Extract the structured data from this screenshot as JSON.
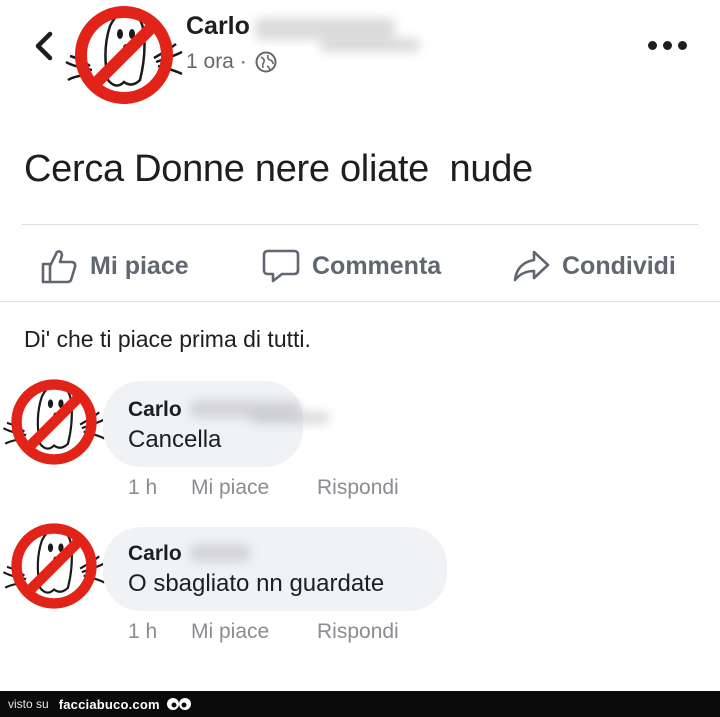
{
  "header": {
    "author_name": "Carlo",
    "timestamp": "1 ora ·",
    "icons": {
      "back": "chevron-left-icon",
      "privacy": "globe-icon",
      "more": "more-dots-icon"
    }
  },
  "post": {
    "text": "Cerca Donne nere oliate  nude"
  },
  "actions": {
    "like": {
      "label": "Mi piace",
      "icon": "thumbs-up-icon"
    },
    "comment": {
      "label": "Commenta",
      "icon": "comment-icon"
    },
    "share": {
      "label": "Condividi",
      "icon": "share-icon"
    }
  },
  "comments_prompt": "Di' che ti piace prima di tutti.",
  "comments": [
    {
      "author": "Carlo",
      "text": "Cancella",
      "time": "1 h",
      "like": "Mi piace",
      "reply": "Rispondi"
    },
    {
      "author": "Carlo",
      "text": "O sbagliato nn guardate",
      "time": "1 h",
      "like": "Mi piace",
      "reply": "Rispondi"
    }
  ],
  "footer": {
    "visto_su": "visto su",
    "brand": "facciabuco.com"
  },
  "colors": {
    "accent_red": "#e2231a",
    "text": "#1c1e21",
    "muted": "#606770",
    "bubble": "#f0f2f5"
  }
}
